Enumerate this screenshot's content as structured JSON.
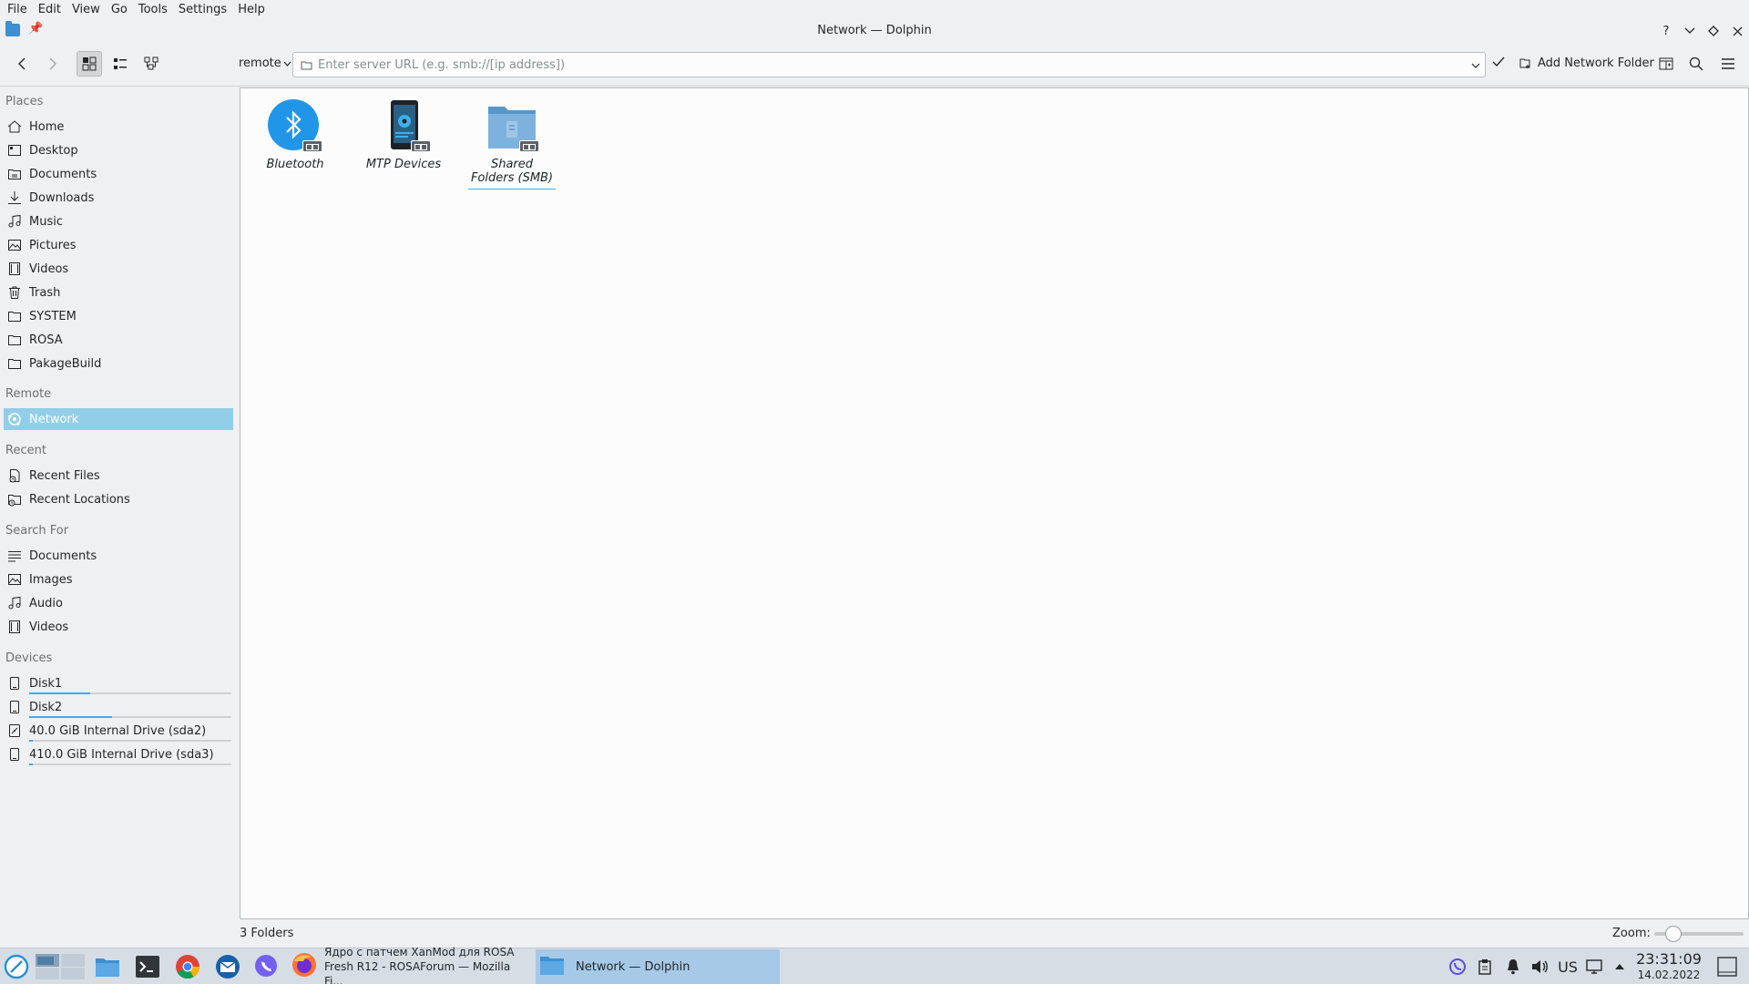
{
  "menu": [
    "File",
    "Edit",
    "View",
    "Go",
    "Tools",
    "Settings",
    "Help"
  ],
  "window": {
    "title": "Network — Dolphin"
  },
  "toolbar": {
    "scheme": "remote",
    "url_placeholder": "Enter server URL (e.g. smb://[ip address])",
    "add_network_label": "Add Network Folder"
  },
  "sidebar": {
    "places_title": "Places",
    "places": [
      "Home",
      "Desktop",
      "Documents",
      "Downloads",
      "Music",
      "Pictures",
      "Videos",
      "Trash",
      "SYSTEM",
      "ROSA",
      "PakageBuild"
    ],
    "remote_title": "Remote",
    "remote": [
      "Network"
    ],
    "recent_title": "Recent",
    "recent": [
      "Recent Files",
      "Recent Locations"
    ],
    "search_title": "Search For",
    "search": [
      "Documents",
      "Images",
      "Audio",
      "Videos"
    ],
    "devices_title": "Devices",
    "devices": [
      {
        "label": "Disk1",
        "usage": 0.3
      },
      {
        "label": "Disk2",
        "usage": 0.41
      },
      {
        "label": "40.0 GiB Internal Drive (sda2)",
        "usage": 0.02
      },
      {
        "label": "410.0 GiB Internal Drive (sda3)",
        "usage": 0.02
      }
    ]
  },
  "items": [
    {
      "label": "Bluetooth",
      "icon": "bluetooth-icon"
    },
    {
      "label": "MTP Devices",
      "icon": "mtp-device-icon"
    },
    {
      "label": "Shared Folders (SMB)",
      "icon": "smb-folder-icon"
    }
  ],
  "status": {
    "count": "3 Folders",
    "zoom_label": "Zoom:",
    "zoom_level": 0.15
  },
  "taskbar": {
    "tasks": [
      {
        "label_line1": "Ядро с патчем XanMod для ROSA",
        "label_line2": "Fresh R12 - ROSAForum — Mozilla Fi..."
      },
      {
        "label": "Network — Dolphin"
      }
    ],
    "keyboard_layout": "US",
    "time": "23:31:09",
    "date": "14.02.2022"
  },
  "colors": {
    "accent": "#3daee9",
    "selection": "#93cee9",
    "taskbar": "#d6dde5"
  }
}
